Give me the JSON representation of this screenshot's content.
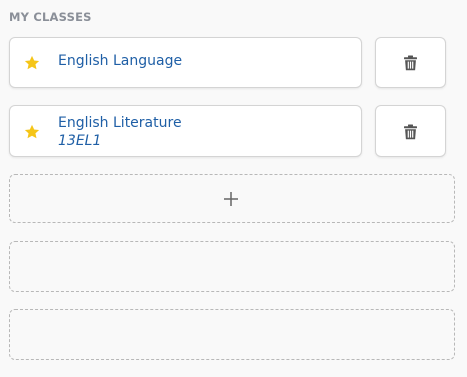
{
  "section": {
    "title": "MY CLASSES"
  },
  "classes": [
    {
      "name": "English Language",
      "code": "",
      "favorite": true,
      "icon": "star-icon",
      "delete_icon": "trash-icon"
    },
    {
      "name": "English Literature",
      "code": "13EL1",
      "favorite": true,
      "icon": "star-icon",
      "delete_icon": "trash-icon"
    }
  ],
  "add_slot": {
    "icon": "plus-icon"
  },
  "colors": {
    "star": "#f5c518",
    "class_text": "#1f5fa6",
    "section_title": "#8a8f98",
    "icon_gray": "#555555",
    "dashed_border": "#b8b8b8"
  }
}
